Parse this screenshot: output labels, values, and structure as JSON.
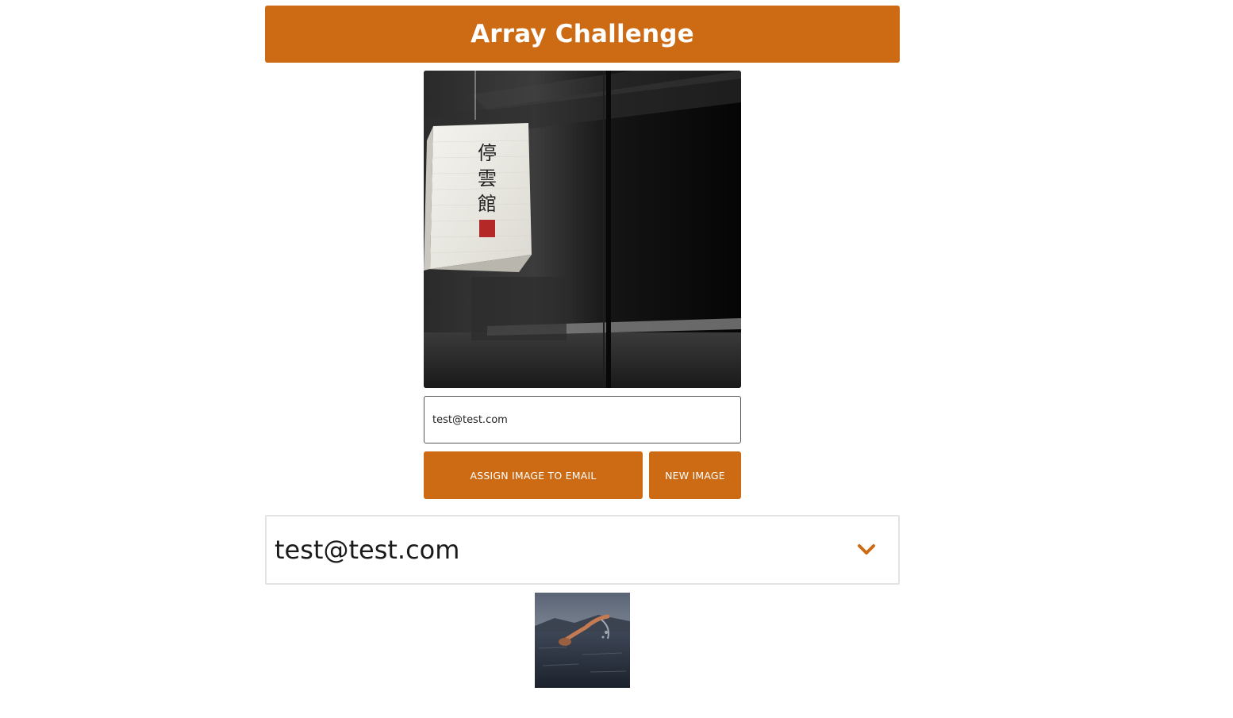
{
  "header": {
    "title": "Array Challenge"
  },
  "main_image": {
    "icon": "paper-lantern-photo",
    "lantern_text": "停雲館"
  },
  "email_input": {
    "value": "test@test.com",
    "placeholder": ""
  },
  "buttons": {
    "assign_label": "ASSIGN IMAGE TO EMAIL",
    "new_label": "NEW IMAGE"
  },
  "accordion": {
    "title": "test@test.com",
    "icon": "chevron-down-icon"
  },
  "assigned_images": [
    {
      "icon": "swimmer-photo"
    }
  ],
  "colors": {
    "accent": "#cd6b14",
    "border": "#e3e3e3"
  }
}
